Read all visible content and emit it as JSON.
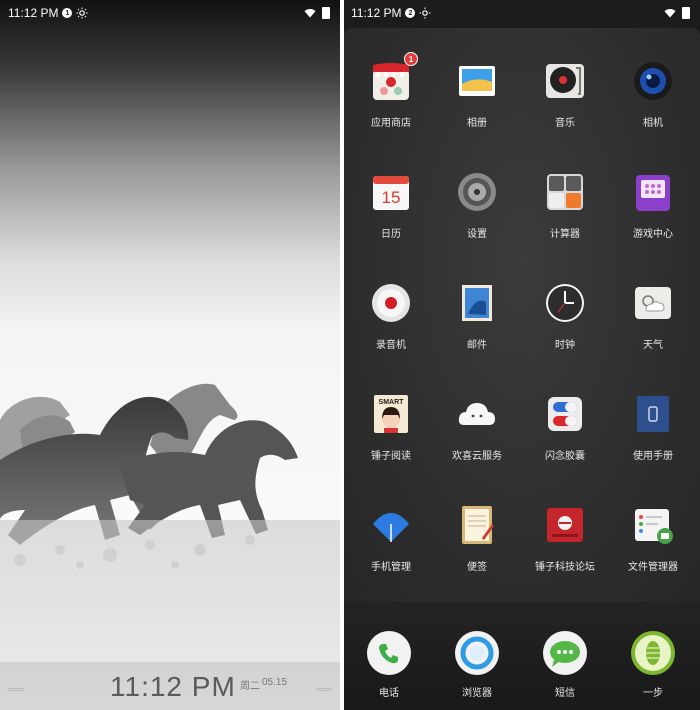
{
  "lock_screen": {
    "status": {
      "time": "11:12 PM",
      "notif_count": "1"
    },
    "clock": "11:12 PM",
    "weekday": "周二",
    "date": "05.15"
  },
  "home_screen": {
    "status": {
      "time": "11:12 PM",
      "notif_count": "2"
    },
    "apps": [
      {
        "label": "应用商店",
        "icon": "app-store-icon",
        "badge": "1"
      },
      {
        "label": "相册",
        "icon": "gallery-icon"
      },
      {
        "label": "音乐",
        "icon": "music-icon"
      },
      {
        "label": "相机",
        "icon": "camera-icon"
      },
      {
        "label": "日历",
        "icon": "calendar-icon",
        "icon_text": "15"
      },
      {
        "label": "设置",
        "icon": "settings-icon"
      },
      {
        "label": "计算器",
        "icon": "calculator-icon"
      },
      {
        "label": "游戏中心",
        "icon": "game-center-icon"
      },
      {
        "label": "录音机",
        "icon": "recorder-icon"
      },
      {
        "label": "邮件",
        "icon": "mail-icon"
      },
      {
        "label": "时钟",
        "icon": "clock-icon"
      },
      {
        "label": "天气",
        "icon": "weather-icon"
      },
      {
        "label": "锤子阅读",
        "icon": "reader-icon",
        "icon_text": "SMART"
      },
      {
        "label": "欢喜云服务",
        "icon": "cloud-service-icon"
      },
      {
        "label": "闪念胶囊",
        "icon": "capsule-icon"
      },
      {
        "label": "使用手册",
        "icon": "manual-icon"
      },
      {
        "label": "手机管理",
        "icon": "phone-manager-icon"
      },
      {
        "label": "便签",
        "icon": "notes-icon"
      },
      {
        "label": "锤子科技论坛",
        "icon": "forum-icon"
      },
      {
        "label": "文件管理器",
        "icon": "file-manager-icon"
      }
    ],
    "dock": [
      {
        "label": "电话",
        "icon": "phone-icon"
      },
      {
        "label": "浏览器",
        "icon": "browser-icon"
      },
      {
        "label": "短信",
        "icon": "sms-icon"
      },
      {
        "label": "一步",
        "icon": "one-step-icon"
      }
    ]
  }
}
